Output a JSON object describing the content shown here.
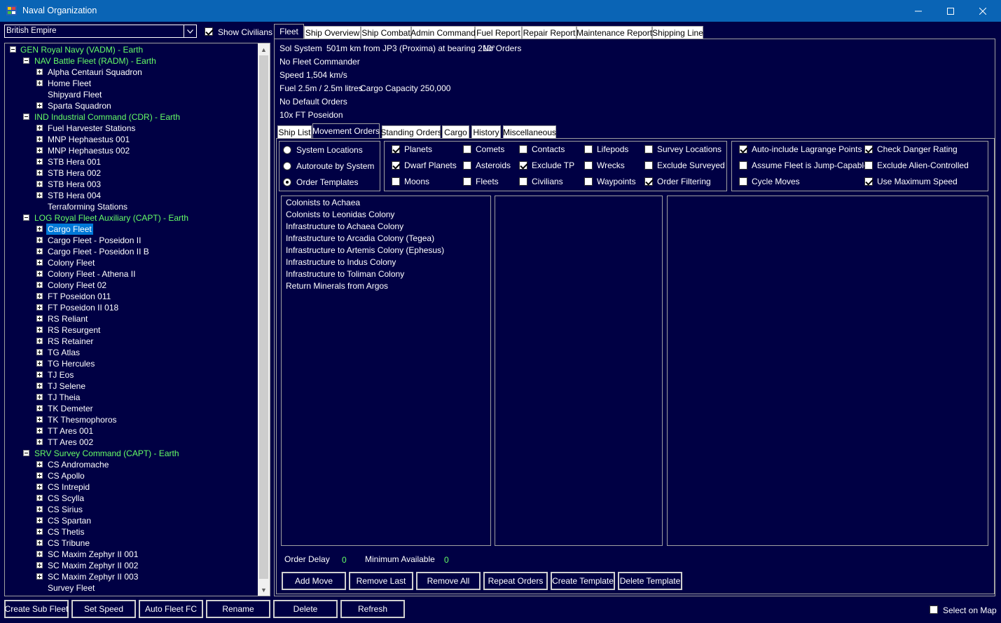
{
  "window": {
    "title": "Naval Organization",
    "minimize_icon": "minimize-icon",
    "maximize_icon": "maximize-icon",
    "close_icon": "close-icon"
  },
  "left": {
    "empire": "British Empire",
    "show_civilians_label": "Show Civilians",
    "show_civilians_checked": true
  },
  "tree": [
    {
      "level": 0,
      "expander": "minus",
      "text": "GEN Royal Navy  (VADM)  -  Earth",
      "type": "cmd"
    },
    {
      "level": 1,
      "expander": "minus",
      "text": "NAV Battle Fleet  (RADM)  -  Earth",
      "type": "cmd"
    },
    {
      "level": 2,
      "expander": "plus",
      "text": "Alpha Centauri Squadron",
      "type": "fleet"
    },
    {
      "level": 2,
      "expander": "plus",
      "text": "Home Fleet",
      "type": "fleet"
    },
    {
      "level": 2,
      "expander": "none",
      "text": "Shipyard Fleet",
      "type": "fleet"
    },
    {
      "level": 2,
      "expander": "plus",
      "text": "Sparta Squadron",
      "type": "fleet"
    },
    {
      "level": 1,
      "expander": "minus",
      "text": "IND Industrial Command  (CDR)  -  Earth",
      "type": "cmd"
    },
    {
      "level": 2,
      "expander": "plus",
      "text": "Fuel Harvester Stations",
      "type": "fleet"
    },
    {
      "level": 2,
      "expander": "plus",
      "text": "MNP Hephaestus 001",
      "type": "fleet"
    },
    {
      "level": 2,
      "expander": "plus",
      "text": "MNP Hephaestus 002",
      "type": "fleet"
    },
    {
      "level": 2,
      "expander": "plus",
      "text": "STB Hera 001",
      "type": "fleet"
    },
    {
      "level": 2,
      "expander": "plus",
      "text": "STB Hera 002",
      "type": "fleet"
    },
    {
      "level": 2,
      "expander": "plus",
      "text": "STB Hera 003",
      "type": "fleet"
    },
    {
      "level": 2,
      "expander": "plus",
      "text": "STB Hera 004",
      "type": "fleet"
    },
    {
      "level": 2,
      "expander": "none",
      "text": "Terraforming Stations",
      "type": "fleet"
    },
    {
      "level": 1,
      "expander": "minus",
      "text": "LOG Royal Fleet Auxiliary  (CAPT)  -  Earth",
      "type": "cmd"
    },
    {
      "level": 2,
      "expander": "plus",
      "text": "Cargo Fleet",
      "type": "fleet",
      "selected": true
    },
    {
      "level": 2,
      "expander": "plus",
      "text": "Cargo Fleet - Poseidon II",
      "type": "fleet"
    },
    {
      "level": 2,
      "expander": "plus",
      "text": "Cargo Fleet - Poseidon II B",
      "type": "fleet"
    },
    {
      "level": 2,
      "expander": "plus",
      "text": "Colony Fleet",
      "type": "fleet"
    },
    {
      "level": 2,
      "expander": "plus",
      "text": "Colony Fleet - Athena II",
      "type": "fleet"
    },
    {
      "level": 2,
      "expander": "plus",
      "text": "Colony Fleet 02",
      "type": "fleet"
    },
    {
      "level": 2,
      "expander": "plus",
      "text": "FT Poseidon 011",
      "type": "fleet"
    },
    {
      "level": 2,
      "expander": "plus",
      "text": "FT Poseidon II 018",
      "type": "fleet"
    },
    {
      "level": 2,
      "expander": "plus",
      "text": "RS Reliant",
      "type": "fleet"
    },
    {
      "level": 2,
      "expander": "plus",
      "text": "RS Resurgent",
      "type": "fleet"
    },
    {
      "level": 2,
      "expander": "plus",
      "text": "RS Retainer",
      "type": "fleet"
    },
    {
      "level": 2,
      "expander": "plus",
      "text": "TG Atlas",
      "type": "fleet"
    },
    {
      "level": 2,
      "expander": "plus",
      "text": "TG Hercules",
      "type": "fleet"
    },
    {
      "level": 2,
      "expander": "plus",
      "text": "TJ Eos",
      "type": "fleet"
    },
    {
      "level": 2,
      "expander": "plus",
      "text": "TJ Selene",
      "type": "fleet"
    },
    {
      "level": 2,
      "expander": "plus",
      "text": "TJ Theia",
      "type": "fleet"
    },
    {
      "level": 2,
      "expander": "plus",
      "text": "TK Demeter",
      "type": "fleet"
    },
    {
      "level": 2,
      "expander": "plus",
      "text": "TK Thesmophoros",
      "type": "fleet"
    },
    {
      "level": 2,
      "expander": "plus",
      "text": "TT Ares 001",
      "type": "fleet"
    },
    {
      "level": 2,
      "expander": "plus",
      "text": "TT Ares 002",
      "type": "fleet"
    },
    {
      "level": 1,
      "expander": "minus",
      "text": "SRV Survey Command  (CAPT)  -  Earth",
      "type": "cmd"
    },
    {
      "level": 2,
      "expander": "plus",
      "text": "CS Andromache",
      "type": "fleet"
    },
    {
      "level": 2,
      "expander": "plus",
      "text": "CS Apollo",
      "type": "fleet"
    },
    {
      "level": 2,
      "expander": "plus",
      "text": "CS Intrepid",
      "type": "fleet"
    },
    {
      "level": 2,
      "expander": "plus",
      "text": "CS Scylla",
      "type": "fleet"
    },
    {
      "level": 2,
      "expander": "plus",
      "text": "CS Sirius",
      "type": "fleet"
    },
    {
      "level": 2,
      "expander": "plus",
      "text": "CS Spartan",
      "type": "fleet"
    },
    {
      "level": 2,
      "expander": "plus",
      "text": "CS Thetis",
      "type": "fleet"
    },
    {
      "level": 2,
      "expander": "plus",
      "text": "CS Tribune",
      "type": "fleet"
    },
    {
      "level": 2,
      "expander": "plus",
      "text": "SC Maxim Zephyr II 001",
      "type": "fleet"
    },
    {
      "level": 2,
      "expander": "plus",
      "text": "SC Maxim Zephyr II 002",
      "type": "fleet"
    },
    {
      "level": 2,
      "expander": "plus",
      "text": "SC Maxim Zephyr II 003",
      "type": "fleet"
    },
    {
      "level": 2,
      "expander": "none",
      "text": "Survey Fleet",
      "type": "fleet"
    }
  ],
  "bottom_buttons": [
    "Create Sub Fleet",
    "Set Speed",
    "Auto Fleet FC",
    "Rename",
    "Delete",
    "Refresh"
  ],
  "select_on_map": {
    "label": "Select on Map",
    "checked": false
  },
  "main_tabs": [
    "Fleet",
    "Ship Overview",
    "Ship Combat",
    "Admin Command",
    "Fuel Report",
    "Repair Report",
    "Maintenance Report",
    "Shipping Line"
  ],
  "fleet_info": {
    "system": "Sol System",
    "location": "501m km from JP3 (Proxima) at bearing 210°",
    "orders": "No Orders",
    "commander": "No Fleet Commander",
    "speed": "Speed 1,504 km/s",
    "fuel": "Fuel 2.5m / 2.5m litres",
    "cargo": "Cargo Capacity 250,000",
    "default_orders": "No Default Orders",
    "ships": "10x FT Poseidon"
  },
  "sub_tabs": [
    "Ship List",
    "Movement Orders",
    "Standing Orders",
    "Cargo",
    "History",
    "Miscellaneous"
  ],
  "radio_options": [
    {
      "label": "System Locations",
      "checked": false
    },
    {
      "label": "Autoroute by System",
      "checked": false
    },
    {
      "label": "Order Templates",
      "checked": true
    }
  ],
  "filter_checks": [
    [
      {
        "label": "Planets",
        "checked": true
      },
      {
        "label": "Dwarf Planets",
        "checked": true
      },
      {
        "label": "Moons",
        "checked": false
      }
    ],
    [
      {
        "label": "Comets",
        "checked": false
      },
      {
        "label": "Asteroids",
        "checked": false
      },
      {
        "label": "Fleets",
        "checked": false
      }
    ],
    [
      {
        "label": "Contacts",
        "checked": false
      },
      {
        "label": "Exclude TP",
        "checked": true
      },
      {
        "label": "Civilians",
        "checked": false
      }
    ],
    [
      {
        "label": "Lifepods",
        "checked": false
      },
      {
        "label": "Wrecks",
        "checked": false
      },
      {
        "label": "Waypoints",
        "checked": false
      }
    ],
    [
      {
        "label": "Survey Locations",
        "checked": false
      },
      {
        "label": "Exclude Surveyed",
        "checked": false
      },
      {
        "label": "Order Filtering",
        "checked": true
      }
    ]
  ],
  "option_checks": [
    [
      {
        "label": "Auto-include Lagrange Points",
        "checked": true
      },
      {
        "label": "Assume Fleet is Jump-Capable",
        "checked": false
      },
      {
        "label": "Cycle Moves",
        "checked": false
      }
    ],
    [
      {
        "label": "Check Danger Rating",
        "checked": true
      },
      {
        "label": "Exclude Alien-Controlled",
        "checked": false
      },
      {
        "label": "Use Maximum Speed",
        "checked": true
      }
    ]
  ],
  "templates": [
    "Colonists to Achaea",
    "Colonists to Leonidas Colony",
    "Infrastructure to Achaea Colony",
    "Infrastructure to Arcadia Colony (Tegea)",
    "Infrastructure to Artemis Colony (Ephesus)",
    "Infrastructure to Indus Colony",
    "Infrastructure to Toliman Colony",
    "Return Minerals from Argos"
  ],
  "order_delay": {
    "label": "Order Delay",
    "value": "0"
  },
  "minimum_available": {
    "label": "Minimum Available",
    "value": "0"
  },
  "order_buttons": [
    "Add Move",
    "Remove Last",
    "Remove All",
    "Repeat Orders",
    "Create Template",
    "Delete Template"
  ],
  "colors": {
    "background": "#000044",
    "titlebar": "#0a64b5",
    "command_text": "#66ff66",
    "selection": "#0078d7"
  }
}
